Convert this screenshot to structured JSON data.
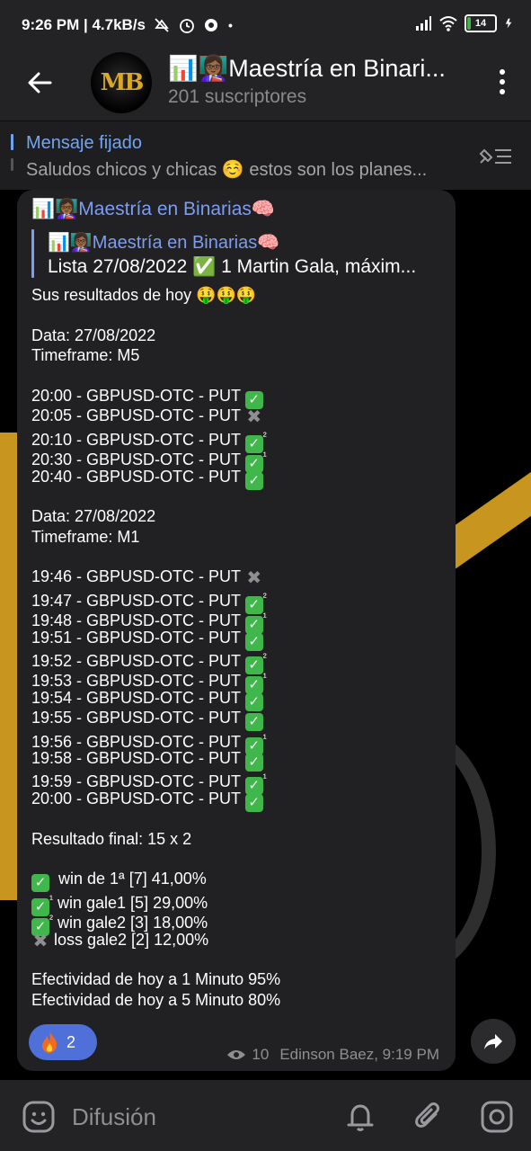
{
  "status_bar": {
    "time_speed": "9:26 PM | 4.7kB/s",
    "battery": "14"
  },
  "header": {
    "title": "📊👩🏾‍🏫Maestría en Binari...",
    "subtitle": "201 suscriptores"
  },
  "pinned": {
    "label": "Mensaje fijado",
    "text": "Saludos chicos y chicas ☺️ estos son los planes..."
  },
  "message": {
    "sender": "📊👩🏾‍🏫Maestría en Binarias🧠",
    "forward_name": "📊👩🏾‍🏫Maestría en Binarias🧠",
    "forward_text": "Lista 27/08/2022 ✅ 1 Martin Gala, máxim...",
    "lines": [
      {
        "t": "Sus resultados de hoy 🤑🤑🤑",
        "m": ""
      },
      {
        "t": "",
        "m": ""
      },
      {
        "t": "Data: 27/08/2022",
        "m": ""
      },
      {
        "t": "Timeframe: M5",
        "m": ""
      },
      {
        "t": "",
        "m": ""
      },
      {
        "t": "20:00 - GBPUSD-OTC - PUT ",
        "m": "ok"
      },
      {
        "t": "20:05 - GBPUSD-OTC - PUT ",
        "m": "x"
      },
      {
        "t": "20:10 - GBPUSD-OTC - PUT ",
        "m": "ok2"
      },
      {
        "t": "20:30 - GBPUSD-OTC - PUT ",
        "m": "ok1"
      },
      {
        "t": "20:40 - GBPUSD-OTC - PUT ",
        "m": "ok"
      },
      {
        "t": "",
        "m": ""
      },
      {
        "t": "Data: 27/08/2022",
        "m": ""
      },
      {
        "t": "Timeframe: M1",
        "m": ""
      },
      {
        "t": "",
        "m": ""
      },
      {
        "t": "19:46 - GBPUSD-OTC - PUT ",
        "m": "x"
      },
      {
        "t": "19:47 - GBPUSD-OTC - PUT ",
        "m": "ok2"
      },
      {
        "t": "19:48 - GBPUSD-OTC - PUT ",
        "m": "ok1"
      },
      {
        "t": "19:51 - GBPUSD-OTC - PUT ",
        "m": "ok"
      },
      {
        "t": "19:52 - GBPUSD-OTC - PUT ",
        "m": "ok2"
      },
      {
        "t": "19:53 - GBPUSD-OTC - PUT ",
        "m": "ok1"
      },
      {
        "t": "19:54 - GBPUSD-OTC - PUT ",
        "m": "ok"
      },
      {
        "t": "19:55 - GBPUSD-OTC - PUT ",
        "m": "ok"
      },
      {
        "t": "19:56 - GBPUSD-OTC - PUT ",
        "m": "ok1"
      },
      {
        "t": "19:58 - GBPUSD-OTC - PUT ",
        "m": "ok"
      },
      {
        "t": "19:59 - GBPUSD-OTC - PUT ",
        "m": "ok1"
      },
      {
        "t": "20:00 - GBPUSD-OTC - PUT ",
        "m": "ok"
      },
      {
        "t": "",
        "m": ""
      },
      {
        "t": "Resultado final: 15 x 2",
        "m": ""
      },
      {
        "t": "",
        "m": ""
      },
      {
        "t": "  win de 1ª [7] 41,00%",
        "m": "pre_ok"
      },
      {
        "t": " win gale1 [5] 29,00%",
        "m": "pre_ok1"
      },
      {
        "t": " win gale2 [3] 18,00%",
        "m": "pre_ok2"
      },
      {
        "t": " loss gale2 [2] 12,00%",
        "m": "pre_x"
      },
      {
        "t": "",
        "m": ""
      },
      {
        "t": "Efectividad de hoy a 1 Minuto 95%",
        "m": ""
      },
      {
        "t": "Efectividad de hoy a 5 Minuto 80%",
        "m": ""
      }
    ],
    "reaction_count": "2",
    "views": "10",
    "author_time": "Edinson Baez, 9:19 PM"
  },
  "bottom_bar": {
    "label": "Difusión"
  },
  "colors": {
    "accent": "#7e9cf0",
    "bubble": "#212123",
    "check": "#3fb74a"
  }
}
